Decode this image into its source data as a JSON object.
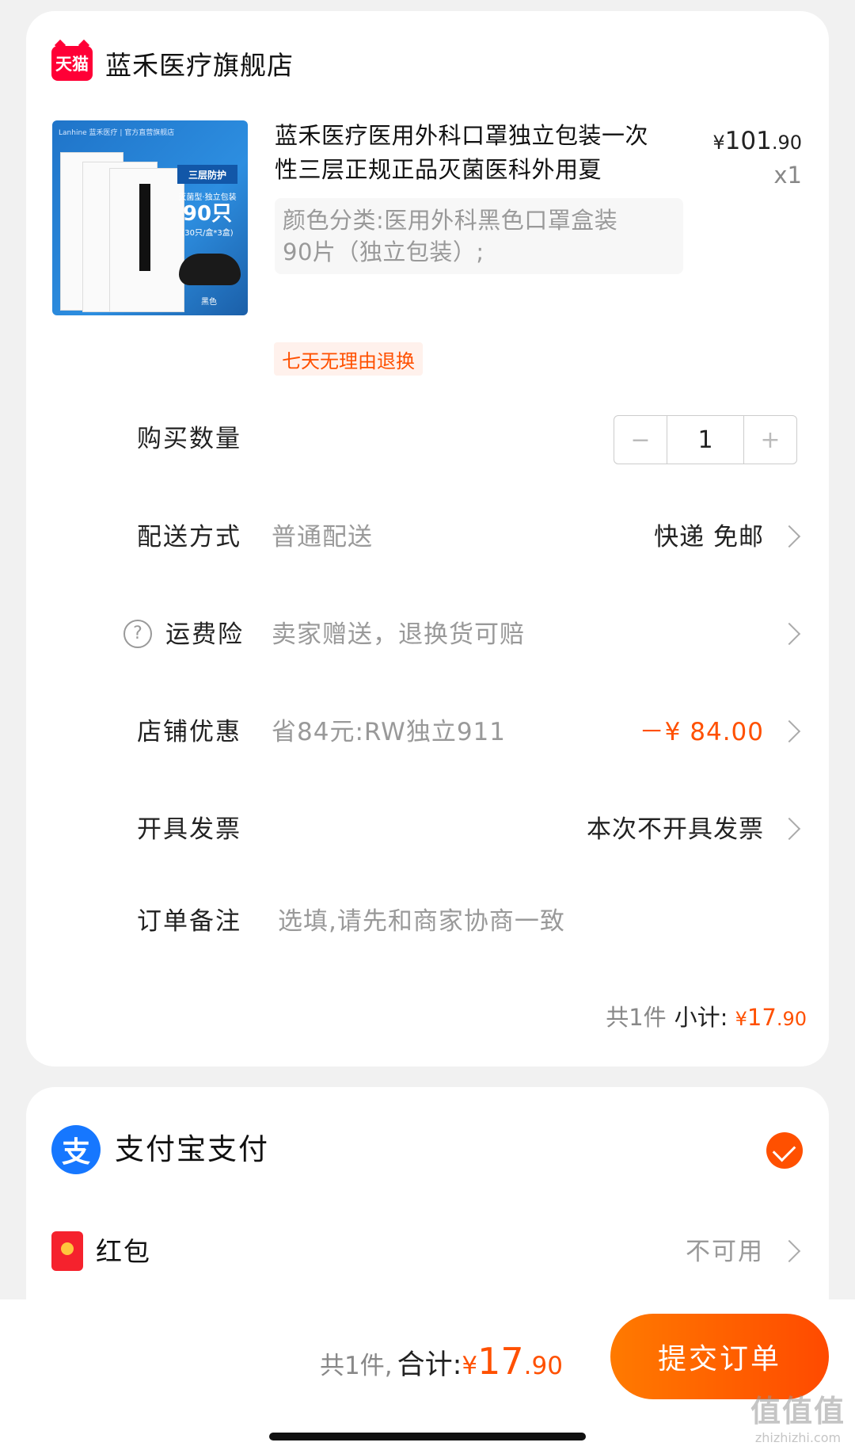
{
  "shop": {
    "badge": "天猫",
    "name": "蓝禾医疗旗舰店"
  },
  "product": {
    "image_texts": {
      "top": "Lanhine 蓝禾医疗 | 官方直营旗舰店",
      "label1": "三层防护",
      "label2": "灭菌型·独立包装",
      "count": "90只",
      "pack": "(30只/盒*3盒)",
      "color": "黑色"
    },
    "title": "蓝禾医疗医用外科口罩独立包装一次性三层正规正品灭菌医科外用夏",
    "price_currency": "¥",
    "price_int": "101",
    "price_dec": ".90",
    "qty": "x1",
    "sku_line1": "颜色分类:医用外科黑色口罩盒装",
    "sku_line2": "90片（独立包装）;",
    "return_tag": "七天无理由退换"
  },
  "quantity": {
    "label": "购买数量",
    "minus": "−",
    "value": "1",
    "plus": "+"
  },
  "delivery": {
    "label": "配送方式",
    "value": "普通配送",
    "right": "快递 免邮"
  },
  "insurance": {
    "icon": "?",
    "label": "运费险",
    "value": "卖家赠送，退换货可赔"
  },
  "discount": {
    "label": "店铺优惠",
    "value": "省84元:RW独立911",
    "right": "－¥ 84.00"
  },
  "invoice": {
    "label": "开具发票",
    "right": "本次不开具发票"
  },
  "remark": {
    "label": "订单备注",
    "placeholder": "选填,请先和商家协商一致"
  },
  "subtotal": {
    "count": "共1件",
    "label": "小计:",
    "currency": "¥",
    "int": "17",
    "dec": ".90"
  },
  "payment": {
    "alipay_icon": "支",
    "alipay_label": "支付宝支付",
    "redpack_label": "红包",
    "redpack_status": "不可用"
  },
  "footer": {
    "count": "共1件,",
    "label": "合计:",
    "currency": "¥",
    "int": "17",
    "dec": ".90",
    "submit": "提交订单"
  },
  "watermark": {
    "main": "值值值",
    "sub": "zhizhizhi.com"
  },
  "colors": {
    "accent": "#ff5000",
    "tmall_red": "#ff0036",
    "alipay_blue": "#1677ff"
  }
}
